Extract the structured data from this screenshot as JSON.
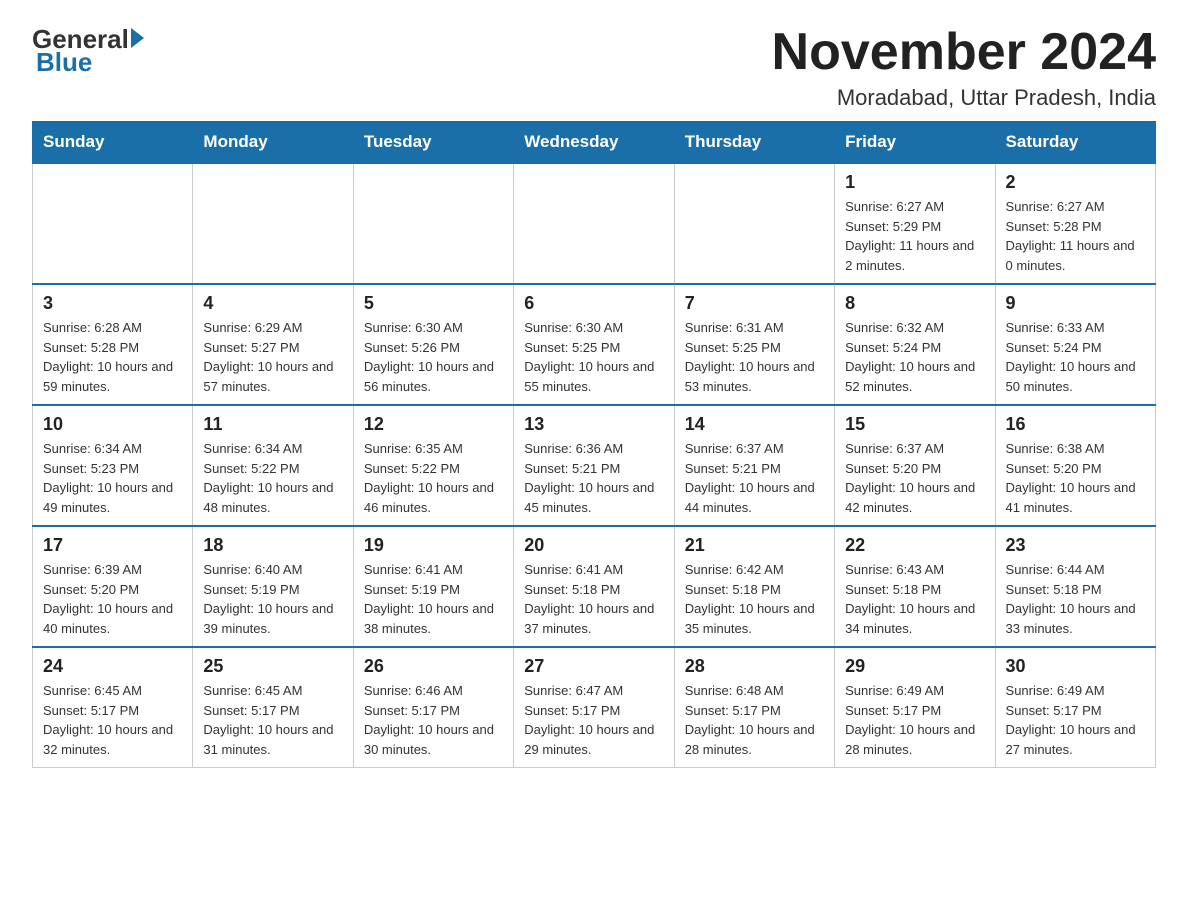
{
  "header": {
    "logo_general": "General",
    "logo_blue": "Blue",
    "month_title": "November 2024",
    "location": "Moradabad, Uttar Pradesh, India"
  },
  "weekdays": [
    "Sunday",
    "Monday",
    "Tuesday",
    "Wednesday",
    "Thursday",
    "Friday",
    "Saturday"
  ],
  "weeks": [
    [
      {
        "day": "",
        "info": ""
      },
      {
        "day": "",
        "info": ""
      },
      {
        "day": "",
        "info": ""
      },
      {
        "day": "",
        "info": ""
      },
      {
        "day": "",
        "info": ""
      },
      {
        "day": "1",
        "info": "Sunrise: 6:27 AM\nSunset: 5:29 PM\nDaylight: 11 hours and 2 minutes."
      },
      {
        "day": "2",
        "info": "Sunrise: 6:27 AM\nSunset: 5:28 PM\nDaylight: 11 hours and 0 minutes."
      }
    ],
    [
      {
        "day": "3",
        "info": "Sunrise: 6:28 AM\nSunset: 5:28 PM\nDaylight: 10 hours and 59 minutes."
      },
      {
        "day": "4",
        "info": "Sunrise: 6:29 AM\nSunset: 5:27 PM\nDaylight: 10 hours and 57 minutes."
      },
      {
        "day": "5",
        "info": "Sunrise: 6:30 AM\nSunset: 5:26 PM\nDaylight: 10 hours and 56 minutes."
      },
      {
        "day": "6",
        "info": "Sunrise: 6:30 AM\nSunset: 5:25 PM\nDaylight: 10 hours and 55 minutes."
      },
      {
        "day": "7",
        "info": "Sunrise: 6:31 AM\nSunset: 5:25 PM\nDaylight: 10 hours and 53 minutes."
      },
      {
        "day": "8",
        "info": "Sunrise: 6:32 AM\nSunset: 5:24 PM\nDaylight: 10 hours and 52 minutes."
      },
      {
        "day": "9",
        "info": "Sunrise: 6:33 AM\nSunset: 5:24 PM\nDaylight: 10 hours and 50 minutes."
      }
    ],
    [
      {
        "day": "10",
        "info": "Sunrise: 6:34 AM\nSunset: 5:23 PM\nDaylight: 10 hours and 49 minutes."
      },
      {
        "day": "11",
        "info": "Sunrise: 6:34 AM\nSunset: 5:22 PM\nDaylight: 10 hours and 48 minutes."
      },
      {
        "day": "12",
        "info": "Sunrise: 6:35 AM\nSunset: 5:22 PM\nDaylight: 10 hours and 46 minutes."
      },
      {
        "day": "13",
        "info": "Sunrise: 6:36 AM\nSunset: 5:21 PM\nDaylight: 10 hours and 45 minutes."
      },
      {
        "day": "14",
        "info": "Sunrise: 6:37 AM\nSunset: 5:21 PM\nDaylight: 10 hours and 44 minutes."
      },
      {
        "day": "15",
        "info": "Sunrise: 6:37 AM\nSunset: 5:20 PM\nDaylight: 10 hours and 42 minutes."
      },
      {
        "day": "16",
        "info": "Sunrise: 6:38 AM\nSunset: 5:20 PM\nDaylight: 10 hours and 41 minutes."
      }
    ],
    [
      {
        "day": "17",
        "info": "Sunrise: 6:39 AM\nSunset: 5:20 PM\nDaylight: 10 hours and 40 minutes."
      },
      {
        "day": "18",
        "info": "Sunrise: 6:40 AM\nSunset: 5:19 PM\nDaylight: 10 hours and 39 minutes."
      },
      {
        "day": "19",
        "info": "Sunrise: 6:41 AM\nSunset: 5:19 PM\nDaylight: 10 hours and 38 minutes."
      },
      {
        "day": "20",
        "info": "Sunrise: 6:41 AM\nSunset: 5:18 PM\nDaylight: 10 hours and 37 minutes."
      },
      {
        "day": "21",
        "info": "Sunrise: 6:42 AM\nSunset: 5:18 PM\nDaylight: 10 hours and 35 minutes."
      },
      {
        "day": "22",
        "info": "Sunrise: 6:43 AM\nSunset: 5:18 PM\nDaylight: 10 hours and 34 minutes."
      },
      {
        "day": "23",
        "info": "Sunrise: 6:44 AM\nSunset: 5:18 PM\nDaylight: 10 hours and 33 minutes."
      }
    ],
    [
      {
        "day": "24",
        "info": "Sunrise: 6:45 AM\nSunset: 5:17 PM\nDaylight: 10 hours and 32 minutes."
      },
      {
        "day": "25",
        "info": "Sunrise: 6:45 AM\nSunset: 5:17 PM\nDaylight: 10 hours and 31 minutes."
      },
      {
        "day": "26",
        "info": "Sunrise: 6:46 AM\nSunset: 5:17 PM\nDaylight: 10 hours and 30 minutes."
      },
      {
        "day": "27",
        "info": "Sunrise: 6:47 AM\nSunset: 5:17 PM\nDaylight: 10 hours and 29 minutes."
      },
      {
        "day": "28",
        "info": "Sunrise: 6:48 AM\nSunset: 5:17 PM\nDaylight: 10 hours and 28 minutes."
      },
      {
        "day": "29",
        "info": "Sunrise: 6:49 AM\nSunset: 5:17 PM\nDaylight: 10 hours and 28 minutes."
      },
      {
        "day": "30",
        "info": "Sunrise: 6:49 AM\nSunset: 5:17 PM\nDaylight: 10 hours and 27 minutes."
      }
    ]
  ]
}
